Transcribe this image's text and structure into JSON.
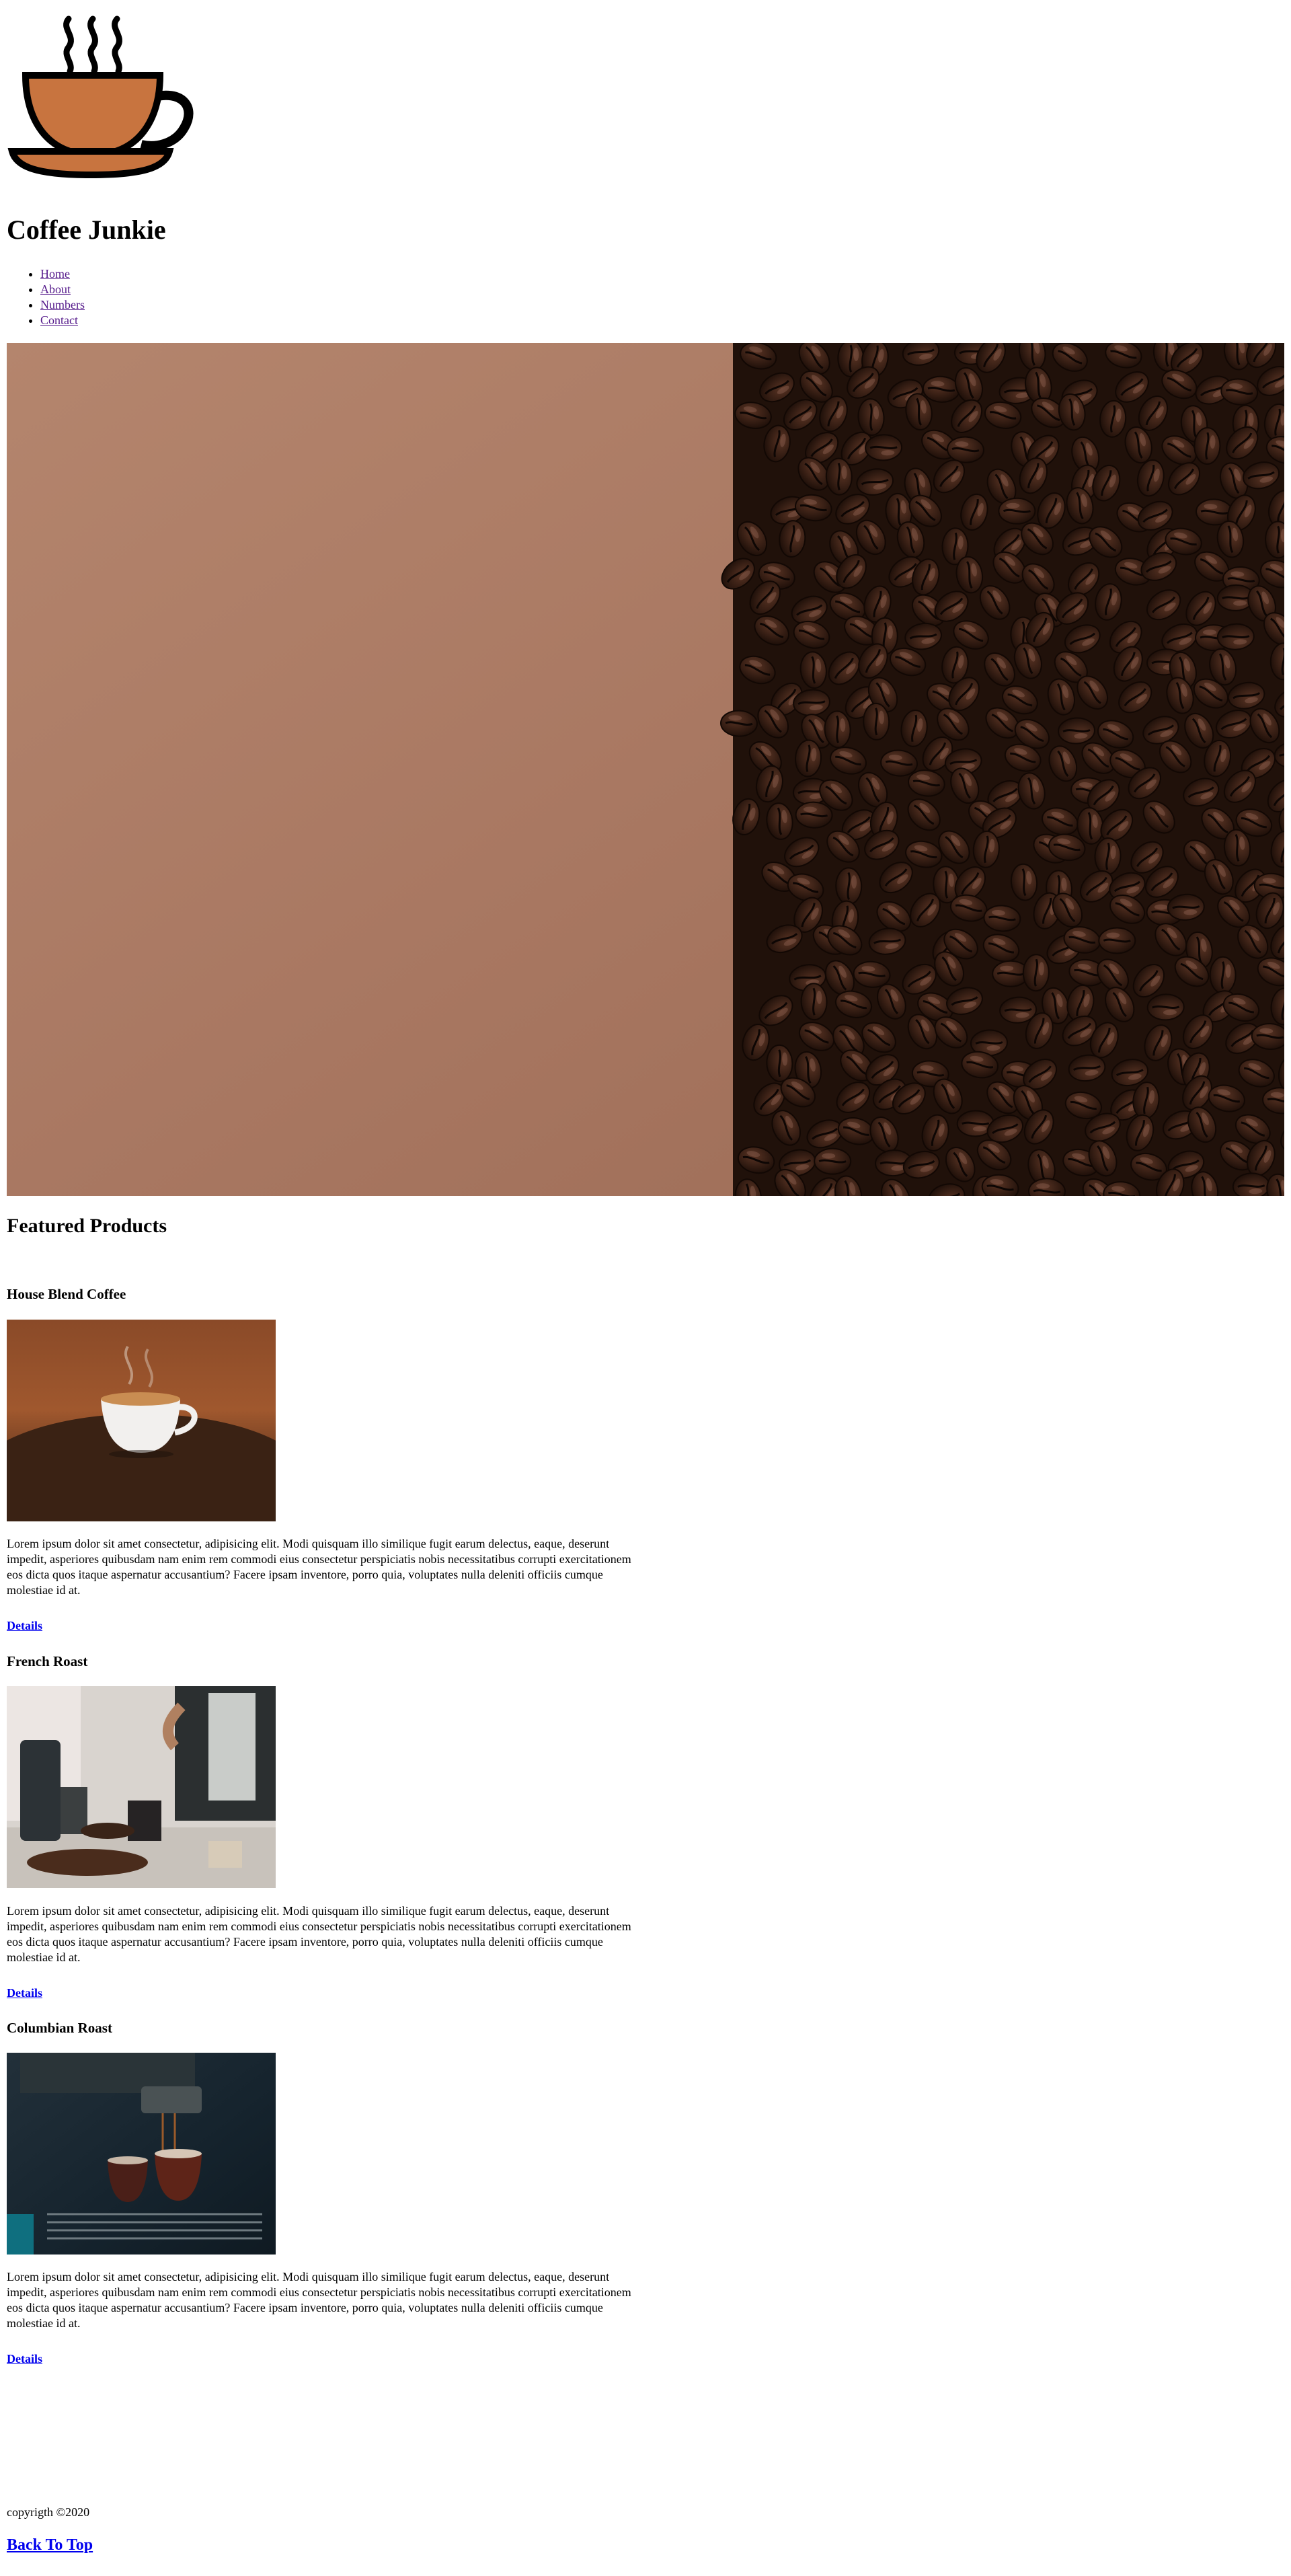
{
  "header": {
    "logo_icon": "coffee-cup-logo-icon",
    "site_title": "Coffee Junkie"
  },
  "nav": {
    "items": [
      {
        "label": "Home"
      },
      {
        "label": "About"
      },
      {
        "label": "Numbers"
      },
      {
        "label": "Contact"
      }
    ]
  },
  "hero": {
    "image": "coffee-beans-on-brown-background"
  },
  "featured": {
    "heading": "Featured Products",
    "products": [
      {
        "title": "House Blend Coffee",
        "image": "cup-of-coffee-on-beans-photo",
        "description": "Lorem ipsum dolor sit amet consectetur, adipisicing elit. Modi quisquam illo similique fugit earum delectus, eaque, deserunt impedit, asperiores quibusdam nam enim rem commodi eius consectetur perspiciatis nobis necessitatibus corrupti exercitationem eos dicta quos itaque aspernatur accusantium? Facere ipsam inventore, porro quia, voluptates nulla deleniti officiis cumque molestiae id at.",
        "details_label": "Details"
      },
      {
        "title": "French Roast",
        "image": "pour-over-coffee-setup-photo",
        "description": "Lorem ipsum dolor sit amet consectetur, adipisicing elit. Modi quisquam illo similique fugit earum delectus, eaque, deserunt impedit, asperiores quibusdam nam enim rem commodi eius consectetur perspiciatis nobis necessitatibus corrupti exercitationem eos dicta quos itaque aspernatur accusantium? Facere ipsam inventore, porro quia, voluptates nulla deleniti officiis cumque molestiae id at.",
        "details_label": "Details"
      },
      {
        "title": "Columbian Roast",
        "image": "espresso-machine-cups-photo",
        "description": "Lorem ipsum dolor sit amet consectetur, adipisicing elit. Modi quisquam illo similique fugit earum delectus, eaque, deserunt impedit, asperiores quibusdam nam enim rem commodi eius consectetur perspiciatis nobis necessitatibus corrupti exercitationem eos dicta quos itaque aspernatur accusantium? Facere ipsam inventore, porro quia, voluptates nulla deleniti officiis cumque molestiae id at.",
        "details_label": "Details"
      }
    ]
  },
  "footer": {
    "copyright": "copyrigth ©2020",
    "back_to_top": "Back To Top"
  },
  "colors": {
    "link": "#0000ee",
    "visited_link": "#551a8b",
    "cup_orange": "#c8743f",
    "hero_brown": "#a97862"
  }
}
